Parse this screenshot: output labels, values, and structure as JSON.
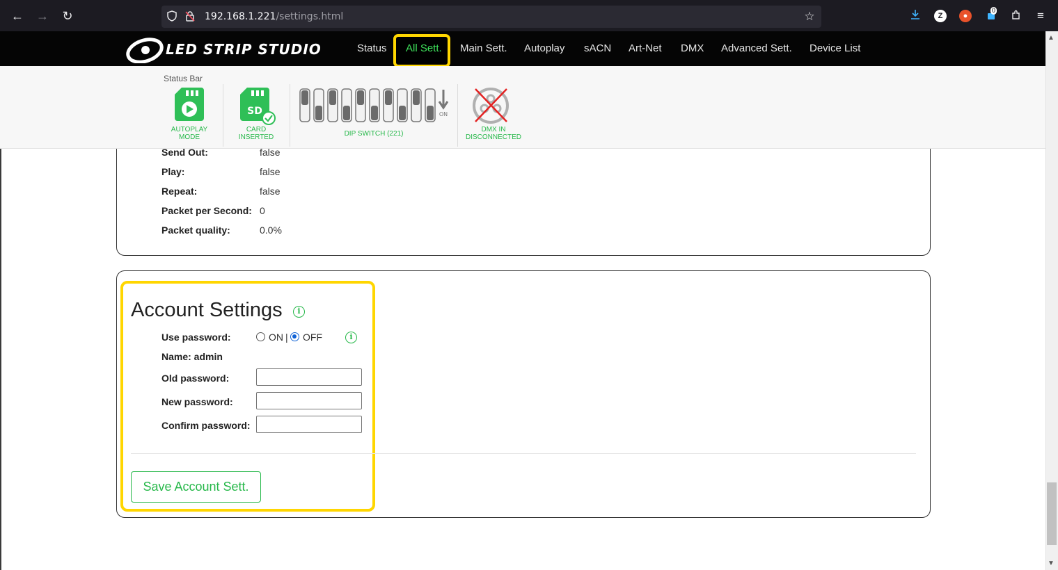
{
  "browser": {
    "url_host": "192.168.1.221",
    "url_path": "/settings.html",
    "badge_count": "0"
  },
  "site": {
    "logo_text": "LED STRIP STUDIO",
    "menu": [
      "Status",
      "All Sett.",
      "Main Sett.",
      "Autoplay",
      "sACN",
      "Art-Net",
      "DMX",
      "Advanced Sett.",
      "Device List"
    ],
    "active_menu": "All Sett."
  },
  "status_bar": {
    "title": "Status Bar",
    "autoplay": {
      "line1": "AUTOPLAY",
      "line2": "MODE"
    },
    "card": {
      "line1": "CARD",
      "line2": "INSERTED",
      "icon_text": "SD"
    },
    "dip": {
      "caption": "DIP SWITCH (221)",
      "on_label": "ON"
    },
    "dmx": {
      "line1": "DMX IN",
      "line2": "DISCONNECTED"
    }
  },
  "stats": [
    {
      "label": "Send Out:",
      "value": "false"
    },
    {
      "label": "Play:",
      "value": "false"
    },
    {
      "label": "Repeat:",
      "value": "false"
    },
    {
      "label": "Packet per Second:",
      "value": "0"
    },
    {
      "label": "Packet quality:",
      "value": "0.0%"
    }
  ],
  "account": {
    "title": "Account Settings",
    "use_password_label": "Use password:",
    "on_label": "ON",
    "sep": "|",
    "off_label": "OFF",
    "name_label": "Name: admin",
    "old_label": "Old password:",
    "new_label": "New password:",
    "confirm_label": "Confirm password:",
    "save_label": "Save Account Sett."
  },
  "colors": {
    "accent": "#27b84a",
    "highlight": "#ffd600",
    "navbar": "#050505"
  }
}
